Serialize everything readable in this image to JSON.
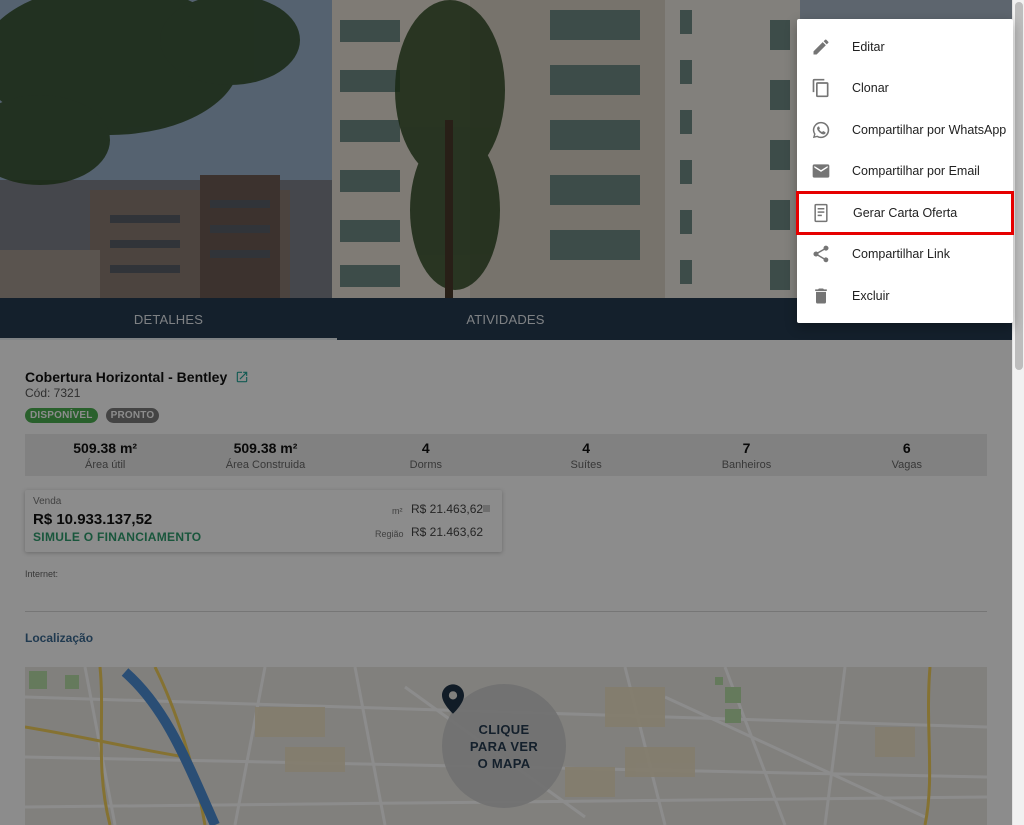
{
  "tabs": [
    {
      "label": "DETALHES",
      "active": true
    },
    {
      "label": "ATIVIDADES",
      "active": false
    }
  ],
  "property": {
    "title": "Cobertura Horizontal - Bentley",
    "code": "Cód: 7321",
    "badges": [
      "DISPONÍVEL",
      "PRONTO"
    ]
  },
  "stats": [
    {
      "value": "509.38 m²",
      "label": "Área útil"
    },
    {
      "value": "509.38 m²",
      "label": "Área Construida"
    },
    {
      "value": "4",
      "label": "Dorms"
    },
    {
      "value": "4",
      "label": "Suítes"
    },
    {
      "value": "7",
      "label": "Banheiros"
    },
    {
      "value": "6",
      "label": "Vagas"
    }
  ],
  "price": {
    "sale_label": "Venda",
    "amount": "R$ 10.933.137,52",
    "simulate": "SIMULE O FINANCIAMENTO",
    "m2_label": "m²",
    "m2_value": "R$ 21.463,62",
    "region_label": "Região",
    "region_value": "R$ 21.463,62"
  },
  "internet_label": "Internet:",
  "location": {
    "title": "Localização",
    "cta": [
      "CLIQUE",
      "PARA VER",
      "O MAPA"
    ]
  },
  "menu": {
    "items": [
      {
        "label": "Editar",
        "icon": "pencil-icon"
      },
      {
        "label": "Clonar",
        "icon": "copy-icon"
      },
      {
        "label": "Compartilhar por WhatsApp",
        "icon": "whatsapp-icon"
      },
      {
        "label": "Compartilhar por Email",
        "icon": "email-icon"
      },
      {
        "label": "Gerar Carta Oferta",
        "icon": "document-icon",
        "highlighted": true
      },
      {
        "label": "Compartilhar Link",
        "icon": "share-icon"
      },
      {
        "label": "Excluir",
        "icon": "trash-icon"
      }
    ]
  },
  "colors": {
    "tab_bar": "#263b50",
    "available_badge": "#4caf50",
    "ready_badge": "#7d7d7d",
    "simulate_link": "#2e9d6e",
    "location_title": "#3b6a93",
    "highlight_outline": "#e60000"
  }
}
